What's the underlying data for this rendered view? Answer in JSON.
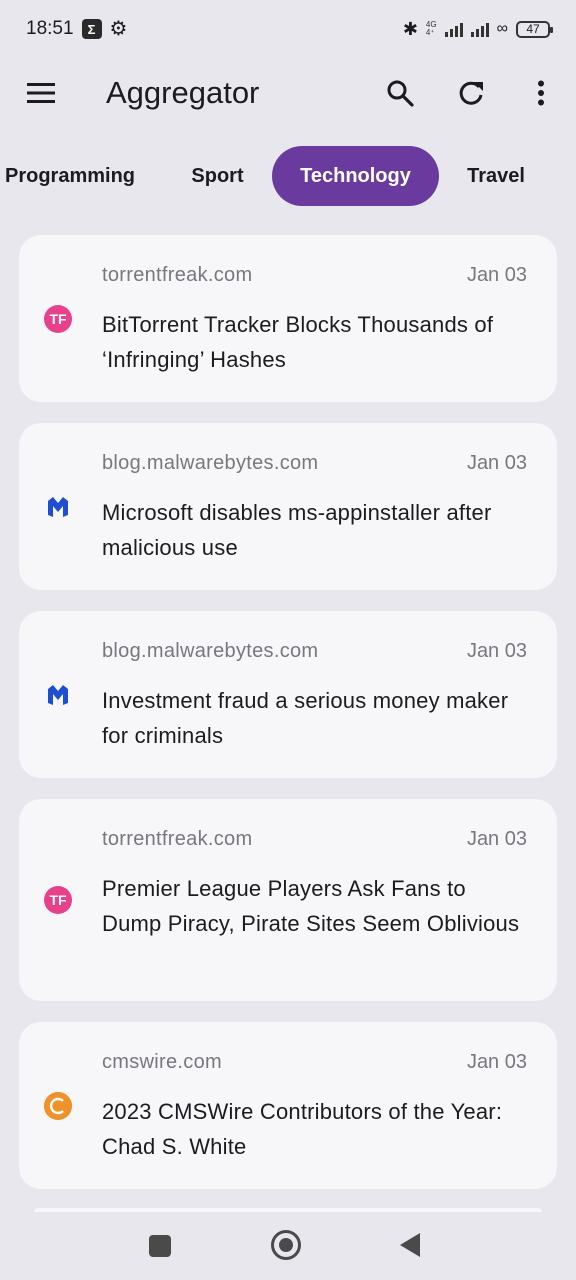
{
  "status_bar": {
    "time": "18:51",
    "network": "4G",
    "battery": "47"
  },
  "app_bar": {
    "title": "Aggregator",
    "menu_icon": "hamburger-menu-icon",
    "search_icon": "search-icon",
    "refresh_icon": "refresh-icon",
    "more_icon": "more-vert-icon"
  },
  "tabs": [
    {
      "label": "Programming",
      "selected": false
    },
    {
      "label": "Sport",
      "selected": false
    },
    {
      "label": "Technology",
      "selected": true
    },
    {
      "label": "Travel",
      "selected": false
    }
  ],
  "colors": {
    "accent": "#6a3a9f",
    "background": "#e9e7ee",
    "card": "#f7f7fa"
  },
  "articles": [
    {
      "source": "torrentfreak.com",
      "date": "Jan 03",
      "title": "BitTorrent Tracker Blocks Thousands of ‘Infringing’ Hashes",
      "favicon": "torrentfreak-icon",
      "favicon_text": "TF"
    },
    {
      "source": "blog.malwarebytes.com",
      "date": "Jan 03",
      "title": "Microsoft disables ms-appinstaller after malicious use",
      "favicon": "malwarebytes-icon",
      "favicon_text": ""
    },
    {
      "source": "blog.malwarebytes.com",
      "date": "Jan 03",
      "title": "Investment fraud a serious money maker for criminals",
      "favicon": "malwarebytes-icon",
      "favicon_text": ""
    },
    {
      "source": "torrentfreak.com",
      "date": "Jan 03",
      "title": "Premier League Players Ask Fans to Dump Piracy, Pirate Sites Seem Oblivious",
      "favicon": "torrentfreak-icon",
      "favicon_text": "TF"
    },
    {
      "source": "cmswire.com",
      "date": "Jan 03",
      "title": "2023 CMSWire Contributors of the Year: Chad S. White",
      "favicon": "cmswire-icon",
      "favicon_text": ""
    }
  ]
}
